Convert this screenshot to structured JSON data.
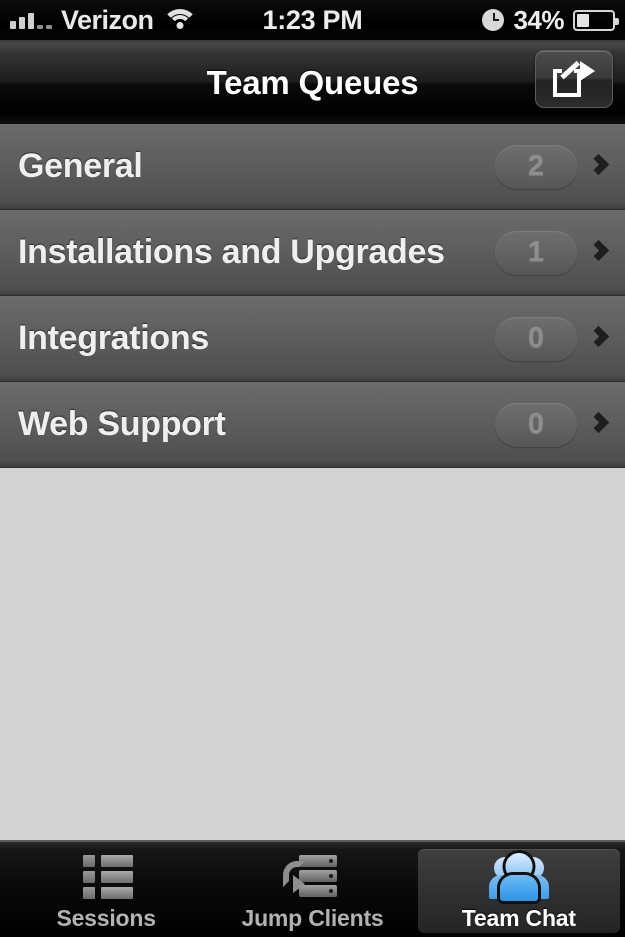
{
  "status_bar": {
    "carrier": "Verizon",
    "time": "1:23 PM",
    "battery_percent": "34%",
    "signal_icon": "signal-bars-icon",
    "wifi_icon": "wifi-icon",
    "clock_icon": "clock-icon",
    "battery_icon": "battery-icon",
    "battery_fill_ratio": 0.34
  },
  "nav_bar": {
    "title": "Team Queues",
    "share_icon": "share-icon"
  },
  "queues": [
    {
      "label": "General",
      "count": "2"
    },
    {
      "label": "Installations and Upgrades",
      "count": "1"
    },
    {
      "label": "Integrations",
      "count": "0"
    },
    {
      "label": "Web Support",
      "count": "0"
    }
  ],
  "tab_bar": {
    "tabs": [
      {
        "label": "Sessions",
        "icon": "list-icon",
        "active": false
      },
      {
        "label": "Jump Clients",
        "icon": "server-arrow-icon",
        "active": false
      },
      {
        "label": "Team Chat",
        "icon": "people-icon",
        "active": true
      }
    ]
  },
  "colors": {
    "accent_blue": "#2e93e6",
    "row_background": "#5e5e5e",
    "empty_area": "#d2d2d2",
    "nav_background": "#101010",
    "active_tab_background": "#343434"
  }
}
